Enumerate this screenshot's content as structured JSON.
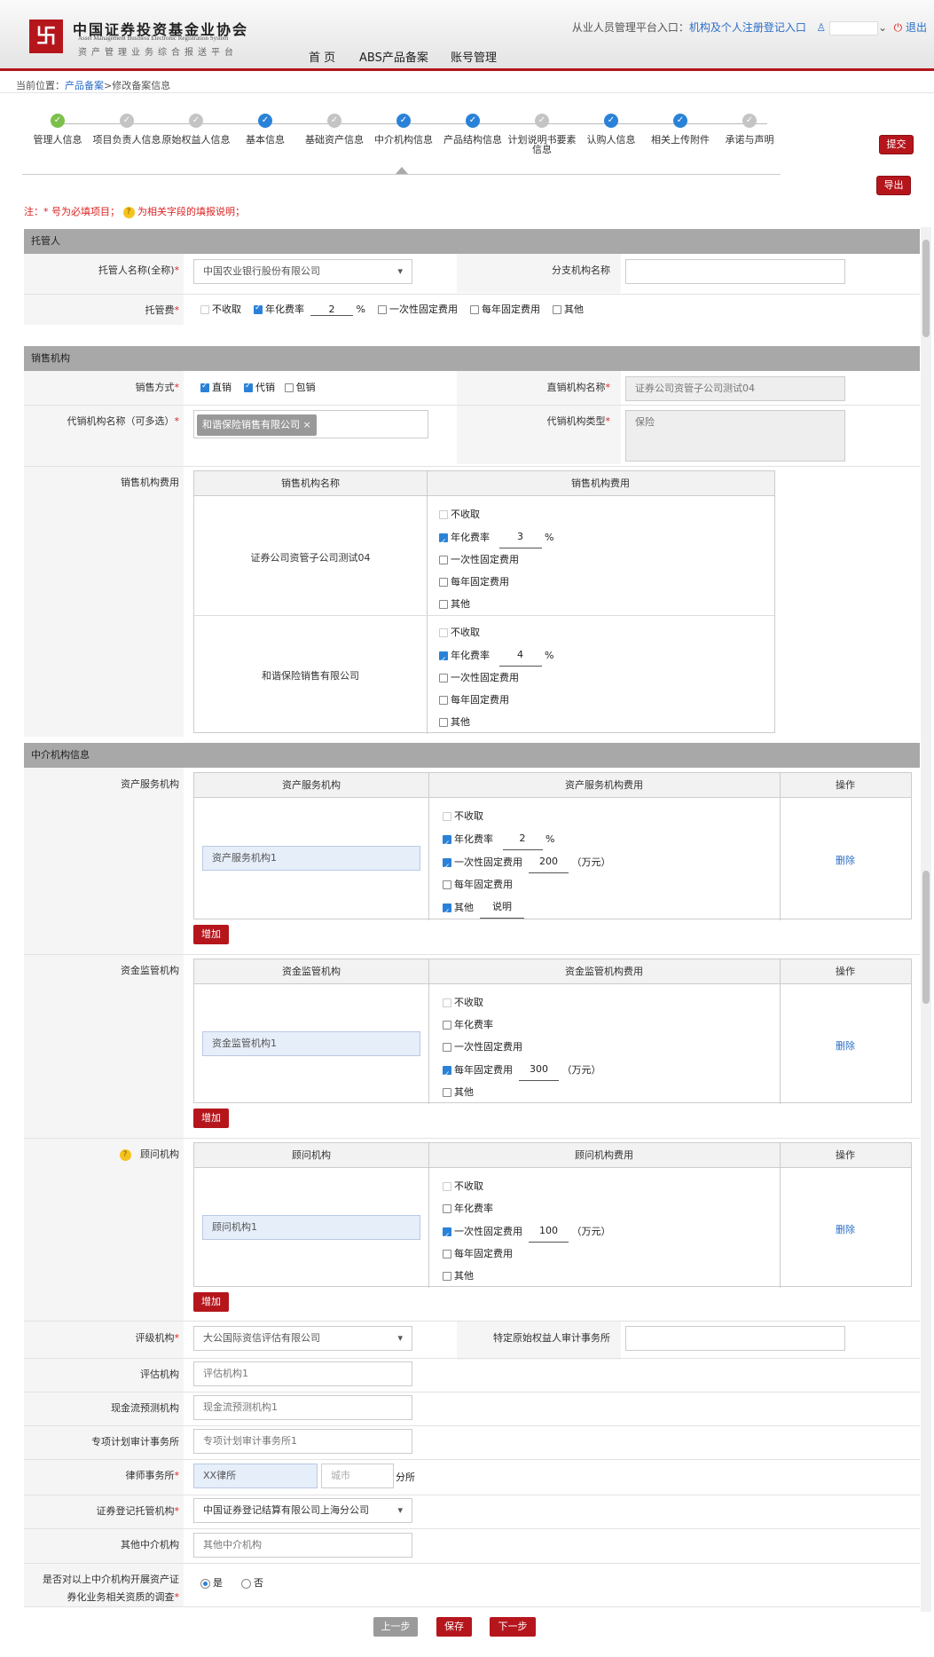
{
  "header": {
    "brand_cn": "中国证券投资基金业协会",
    "brand_en": "Asset Management Business Electronic Registration System",
    "brand_sub": "资产管理业务综合报送平台",
    "logo_glyph": "卐",
    "nav": [
      "首 页",
      "ABS产品备案",
      "账号管理"
    ],
    "entry_text": "从业人员管理平台入口：",
    "entry_link": "机构及个人注册登记入口",
    "logout": "退出"
  },
  "breadcrumb": {
    "prefix": "当前位置：",
    "link": "产品备案",
    "sep": ">",
    "current": "修改备案信息"
  },
  "steps": [
    {
      "label": "管理人信息",
      "state": "done"
    },
    {
      "label": "项目负责人信息",
      "state": "pending"
    },
    {
      "label": "原始权益人信息",
      "state": "pending"
    },
    {
      "label": "基本信息",
      "state": "filled"
    },
    {
      "label": "基础资产信息",
      "state": "pending"
    },
    {
      "label": "中介机构信息",
      "state": "filled"
    },
    {
      "label": "产品结构信息",
      "state": "filled"
    },
    {
      "label": "计划说明书要素信息",
      "state": "pending"
    },
    {
      "label": "认购人信息",
      "state": "filled"
    },
    {
      "label": "相关上传附件",
      "state": "filled"
    },
    {
      "label": "承诺与声明",
      "state": "pending"
    }
  ],
  "actions": {
    "submit": "提交",
    "export": "导出"
  },
  "note": "注：* 号为必填项目；",
  "note2": "为相关字段的填报说明；",
  "trustee": {
    "section": "托管人",
    "name_label": "托管人名称(全称)",
    "name_value": "中国农业银行股份有限公司",
    "branch_label": "分支机构名称",
    "fee_label": "托管费",
    "fee_opts": {
      "none": "不收取",
      "rate": "年化费率",
      "rate_val": "2",
      "pct": "%",
      "once": "一次性固定费用",
      "yearly": "每年固定费用",
      "other": "其他"
    }
  },
  "sales": {
    "section": "销售机构",
    "method_label": "销售方式",
    "methods": [
      "直销",
      "代销",
      "包销"
    ],
    "direct_label": "直销机构名称",
    "direct_value": "证券公司资管子公司测试04",
    "agent_label": "代销机构名称（可多选）",
    "agent_tag": "和谐保险销售有限公司",
    "agent_type_label": "代销机构类型",
    "agent_type_value": "保险",
    "fee_label": "销售机构费用",
    "col1": "销售机构名称",
    "col2": "销售机构费用",
    "rows": [
      {
        "name": "证券公司资管子公司测试04",
        "rate": "3"
      },
      {
        "name": "和谐保险销售有限公司",
        "rate": "4"
      }
    ]
  },
  "fee_words": {
    "none": "不收取",
    "rate": "年化费率",
    "once": "一次性固定费用",
    "yearly": "每年固定费用",
    "other": "其他",
    "pct": "%",
    "wan": "（万元）",
    "op": "操作",
    "del": "删除",
    "add": "增加"
  },
  "intermediary": {
    "section": "中介机构信息",
    "asset_label": "资产服务机构",
    "asset_col1": "资产服务机构",
    "asset_col2": "资产服务机构费用",
    "asset_value": "资产服务机构1",
    "asset_rate": "2",
    "asset_once": "200",
    "asset_other": "说明",
    "fund_label": "资金监管机构",
    "fund_col1": "资金监管机构",
    "fund_col2": "资金监管机构费用",
    "fund_value": "资金监管机构1",
    "fund_yearly": "300",
    "adv_label": "顾问机构",
    "adv_col1": "顾问机构",
    "adv_col2": "顾问机构费用",
    "adv_value": "顾问机构1",
    "adv_once": "100",
    "rating_label": "评级机构",
    "rating_value": "大公国际资信评估有限公司",
    "audit_label": "特定原始权益人审计事务所",
    "eval_label": "评估机构",
    "eval_value": "评估机构1",
    "cash_label": "现金流预测机构",
    "cash_value": "现金流预测机构1",
    "plan_audit_label": "专项计划审计事务所",
    "plan_audit_value": "专项计划审计事务所1",
    "law_label": "律师事务所",
    "law_value": "XX律所",
    "law_city_ph": "城市",
    "law_branch": "分所",
    "reg_label": "证券登记托管机构",
    "reg_value": "中国证券登记结算有限公司上海分公司",
    "other_label": "其他中介机构",
    "other_value": "其他中介机构",
    "survey_label1": "是否对以上中介机构开展资产证",
    "survey_label2": "券化业务相关资质的调查",
    "yes": "是",
    "no": "否"
  },
  "footer": {
    "prev": "上一步",
    "save": "保存",
    "next": "下一步"
  },
  "colors": {
    "brand_red": "#b5161c",
    "step_done": "#7cc04b",
    "step_filled": "#2a82d8",
    "step_pending": "#c4c4c4"
  }
}
